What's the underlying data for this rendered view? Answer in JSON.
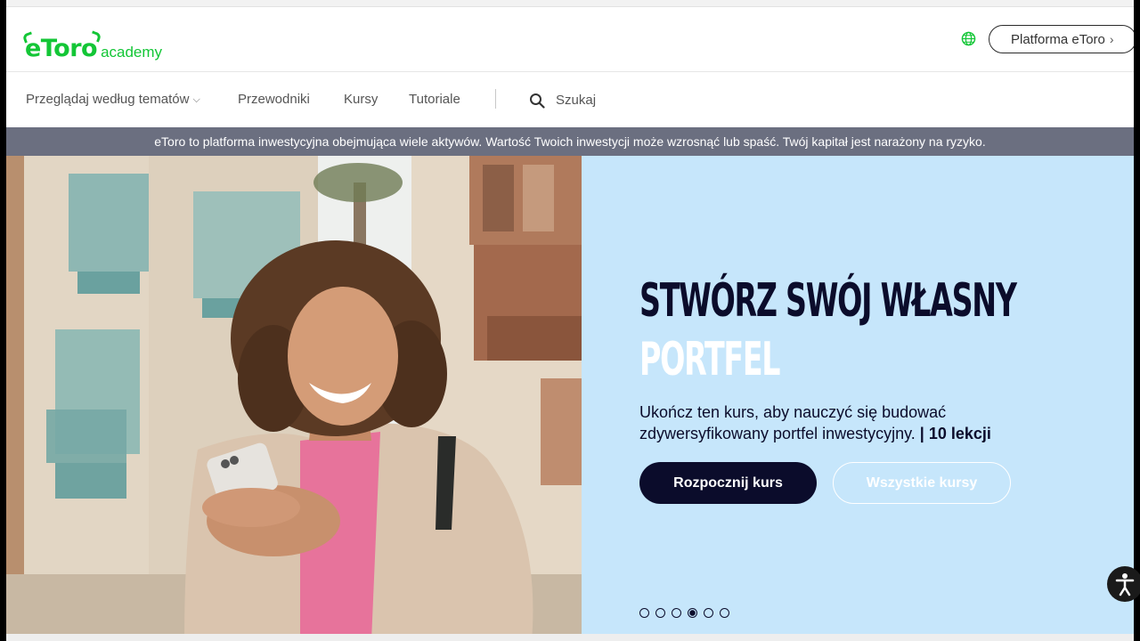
{
  "header": {
    "logo_main": "eToro",
    "logo_sub": "academy",
    "platform_button": "Platforma eToro",
    "icons": {
      "language": "globe-icon",
      "platform_chevron": "chevron-right-icon"
    }
  },
  "nav": {
    "items": [
      {
        "label": "Przeglądaj według tematów",
        "has_dropdown": true
      },
      {
        "label": "Przewodniki"
      },
      {
        "label": "Kursy"
      },
      {
        "label": "Tutoriale"
      }
    ],
    "search_label": "Szukaj",
    "search_icon": "search-icon"
  },
  "risk_banner": "eToro to platforma inwestycyjna obejmująca wiele aktywów. Wartość Twoich inwestycji może wzrosnąć lub spaść. Twój kapitał jest narażony na ryzyko.",
  "hero": {
    "title_line1": "STWÓRZ SWÓJ WŁASNY",
    "title_line2": "PORTFEL",
    "description": "Ukończ ten kurs, aby nauczyć się budować zdywersyfikowany portfel inwestycyjny.",
    "lessons": "| 10 lekcji",
    "primary_button": "Rozpocznij kurs",
    "secondary_button": "Wszystkie kursy",
    "carousel": {
      "total": 6,
      "active_index": 3
    }
  },
  "accessibility_icon": "accessibility-icon",
  "colors": {
    "brand_green": "#13c636",
    "navy": "#0b0c2b",
    "hero_panel": "#c6e6fb",
    "risk_banner": "#6b6f80"
  }
}
